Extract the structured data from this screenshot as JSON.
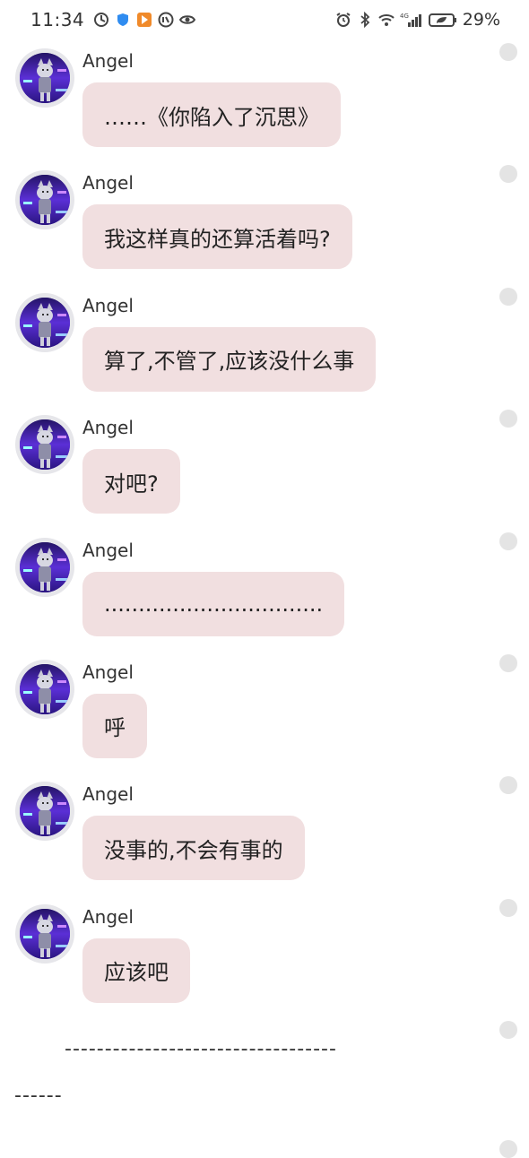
{
  "status_bar": {
    "time": "11:34",
    "battery": "29%",
    "network": "4G",
    "left_icons": [
      "timer-icon",
      "shield-icon",
      "play-icon",
      "app-icon",
      "eye-icon"
    ],
    "right_icons": [
      "alarm-icon",
      "bluetooth-icon",
      "wifi-icon",
      "signal-icon",
      "battery-icon"
    ]
  },
  "messages": [
    {
      "sender": "Angel",
      "text": "……《你陷入了沉思》"
    },
    {
      "sender": "Angel",
      "text": "我这样真的还算活着吗?"
    },
    {
      "sender": "Angel",
      "text": "算了,不管了,应该没什么事"
    },
    {
      "sender": "Angel",
      "text": "对吧?"
    },
    {
      "sender": "Angel",
      "text": "................................"
    },
    {
      "sender": "Angel",
      "text": "呼"
    },
    {
      "sender": "Angel",
      "text": "没事的,不会有事的"
    },
    {
      "sender": "Angel",
      "text": "应该吧"
    }
  ],
  "divider": {
    "line1": "----------------------------------",
    "line2": "------"
  },
  "colors": {
    "bubble": "#f1dfe0",
    "avatar_bg": "#5a2fd0",
    "dot": "#e4e4e4"
  }
}
